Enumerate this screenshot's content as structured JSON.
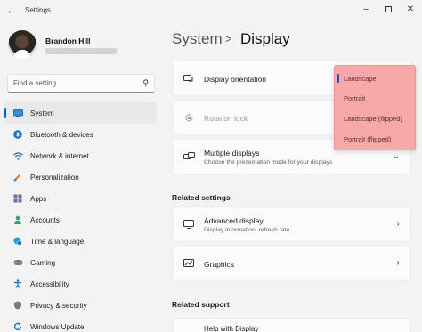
{
  "window": {
    "title": "Settings"
  },
  "user": {
    "name": "Brandon Hill"
  },
  "search": {
    "placeholder": "Find a setting"
  },
  "nav": {
    "items": [
      {
        "label": "System",
        "icon": "monitor-icon",
        "active": true
      },
      {
        "label": "Bluetooth & devices",
        "icon": "bluetooth-icon"
      },
      {
        "label": "Network & internet",
        "icon": "wifi-icon"
      },
      {
        "label": "Personalization",
        "icon": "brush-icon"
      },
      {
        "label": "Apps",
        "icon": "apps-icon"
      },
      {
        "label": "Accounts",
        "icon": "person-icon"
      },
      {
        "label": "Time & language",
        "icon": "globe-clock-icon"
      },
      {
        "label": "Gaming",
        "icon": "controller-icon"
      },
      {
        "label": "Accessibility",
        "icon": "accessibility-icon"
      },
      {
        "label": "Privacy & security",
        "icon": "shield-icon"
      },
      {
        "label": "Windows Update",
        "icon": "update-icon"
      }
    ]
  },
  "header": {
    "parent": "System",
    "separator": ">",
    "current": "Display"
  },
  "settings": {
    "display_orientation": {
      "label": "Display orientation"
    },
    "rotation_lock": {
      "label": "Rotation lock"
    },
    "multiple_displays": {
      "label": "Multiple displays",
      "description": "Choose the presentation mode for your displays"
    }
  },
  "related_settings": {
    "title": "Related settings",
    "advanced_display": {
      "label": "Advanced display",
      "description": "Display information, refresh rate"
    },
    "graphics": {
      "label": "Graphics"
    }
  },
  "related_support": {
    "title": "Related support",
    "help_display": {
      "label": "Help with Display"
    }
  },
  "orientation_dropdown": {
    "options": [
      "Landscape",
      "Portrait",
      "Landscape (flipped)",
      "Portrait (flipped)"
    ],
    "selected": "Landscape",
    "highlight_color": "#f7a8a8"
  },
  "colors": {
    "accent": "#005fb8",
    "background": "#f3f3f3"
  }
}
